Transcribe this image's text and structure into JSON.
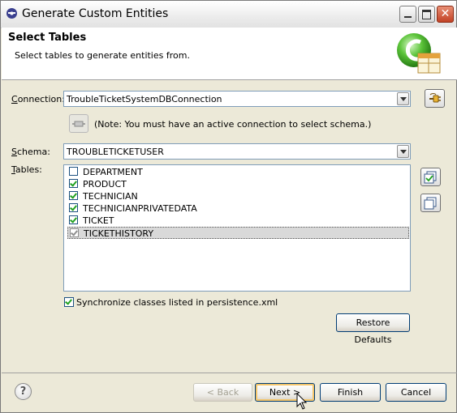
{
  "window": {
    "title": "Generate Custom Entities",
    "close_glyph": "✕"
  },
  "header": {
    "title": "Select Tables",
    "description": "Select tables to generate entities from."
  },
  "connection": {
    "label_prefix": "",
    "label_mnemonic": "C",
    "label_rest": "onnection:",
    "value": "TroubleTicketSystemDBConnection",
    "note": "(Note: You must have an active connection to select schema.)"
  },
  "schema": {
    "label_mnemonic": "S",
    "label_rest": "chema:",
    "value": "TROUBLETICKETUSER"
  },
  "tables": {
    "label_mnemonic": "T",
    "label_rest": "ables:",
    "items": [
      {
        "name": "DEPARTMENT",
        "checked": false
      },
      {
        "name": "PRODUCT",
        "checked": true
      },
      {
        "name": "TECHNICIAN",
        "checked": true
      },
      {
        "name": "TECHNICIANPRIVATEDATA",
        "checked": true
      },
      {
        "name": "TICKET",
        "checked": true
      },
      {
        "name": "TICKETHISTORY",
        "checked": true,
        "selected": true
      }
    ]
  },
  "sync": {
    "checked": true,
    "label": "Synchronize classes listed in persistence.xml"
  },
  "buttons": {
    "restore_defaults": "Restore Defaults",
    "back": "< Back",
    "next": "Next >",
    "finish": "Finish",
    "cancel": "Cancel",
    "help": "?"
  },
  "icons": {
    "app": "eclipse-icon",
    "wizard": "jpa-entities-wizard-icon",
    "add_connection": "connection-plug-icon",
    "reconnect": "reconnect-icon",
    "select_all": "select-all-icon",
    "deselect_all": "deselect-all-icon"
  }
}
